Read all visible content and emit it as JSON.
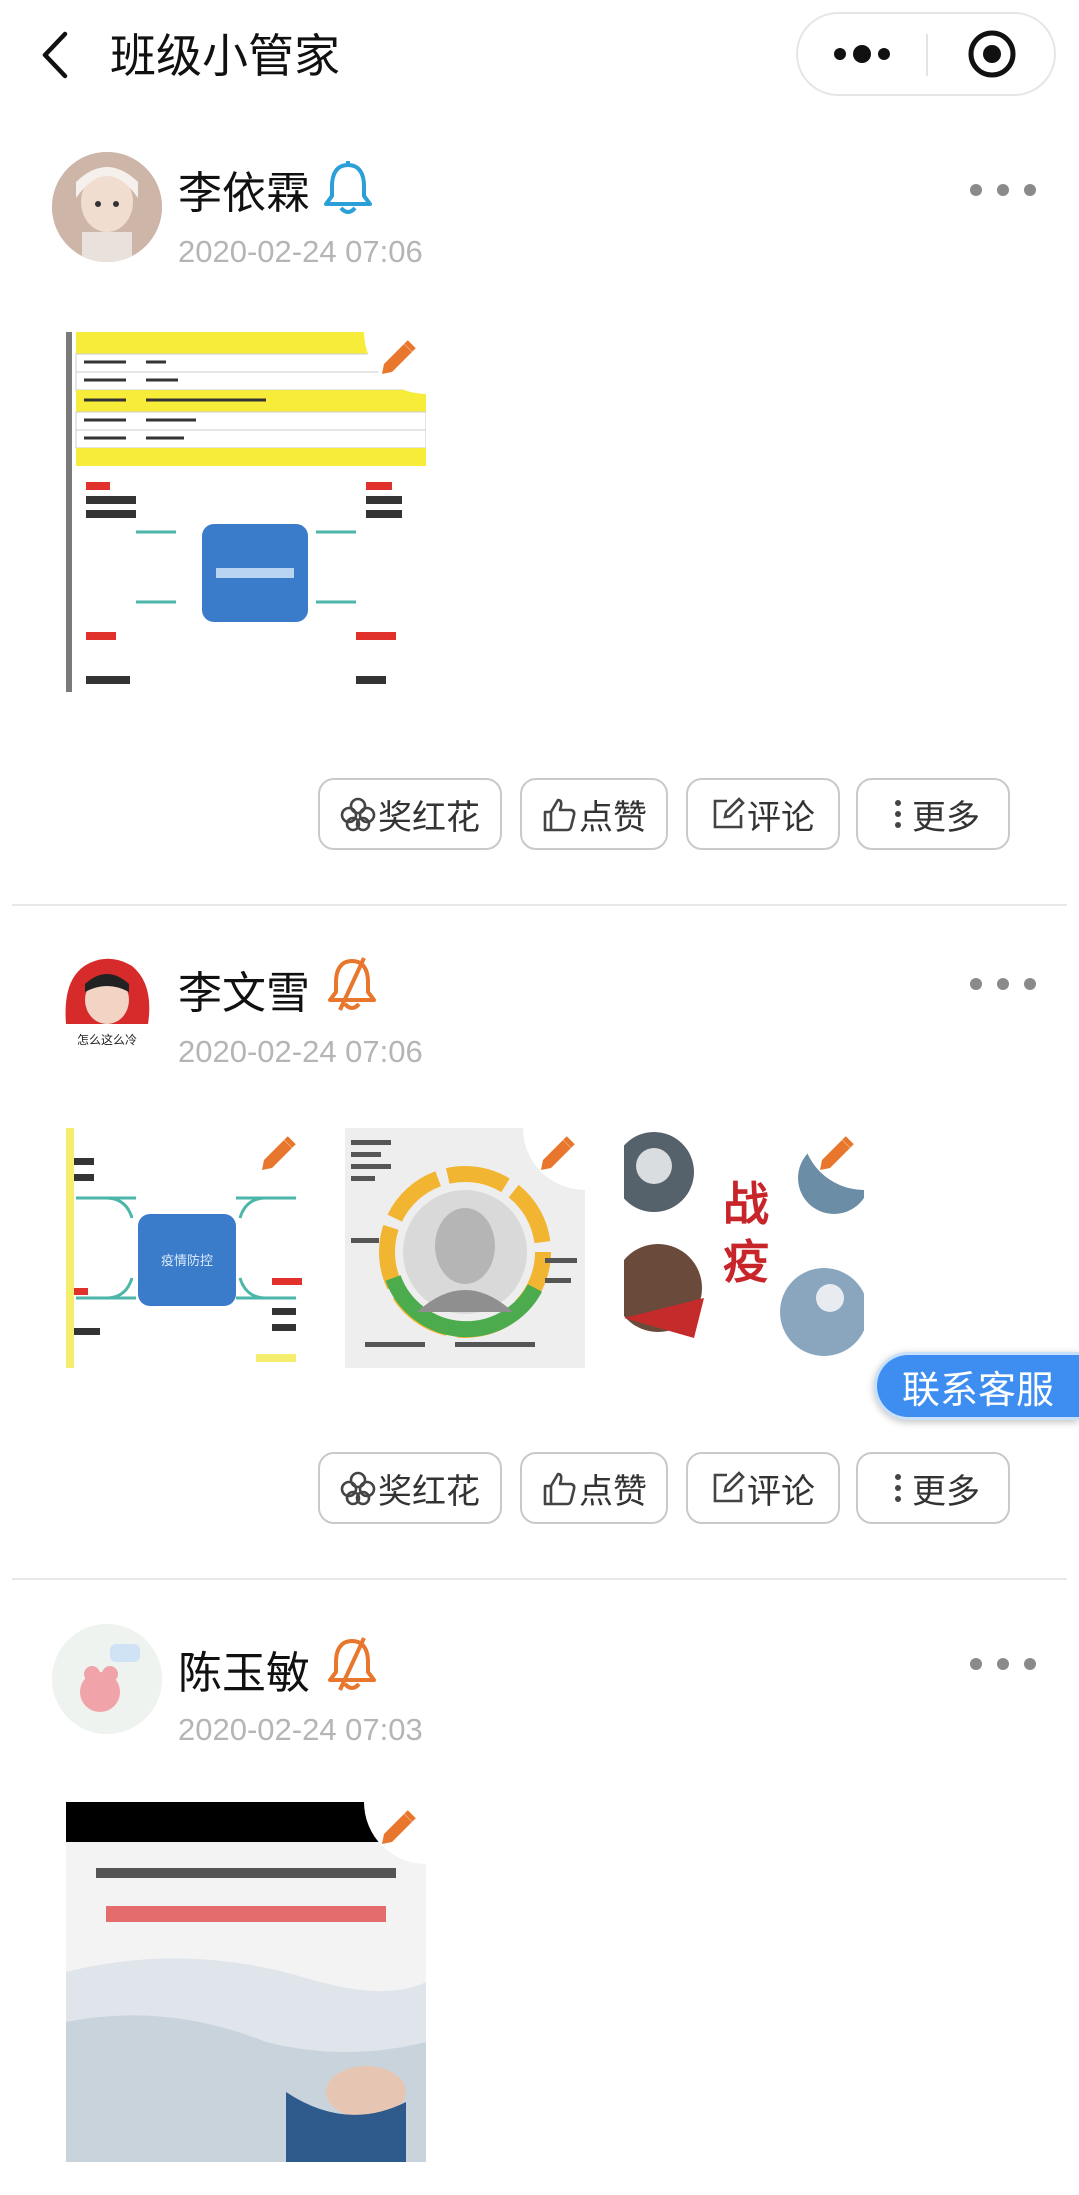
{
  "header": {
    "title": "班级小管家"
  },
  "colors": {
    "accent_orange": "#e8762c",
    "bell_blue": "#2b9fd8",
    "service_blue": "#3d8ef0"
  },
  "actions": {
    "flower": "奖红花",
    "like": "点赞",
    "comment": "评论",
    "more": "更多"
  },
  "posts": [
    {
      "author": "李依霖",
      "time": "2020-02-24 07:06",
      "notify_icon": "bell-icon"
    },
    {
      "author": "李文雪",
      "time": "2020-02-24 07:06",
      "notify_icon": "bell-off-icon"
    },
    {
      "author": "陈玉敏",
      "time": "2020-02-24 07:03",
      "notify_icon": "bell-off-icon"
    }
  ],
  "images": {
    "mindmap_center": "疫情防控",
    "poster_text": "战疫"
  },
  "float": {
    "service_label": "联系客服"
  }
}
